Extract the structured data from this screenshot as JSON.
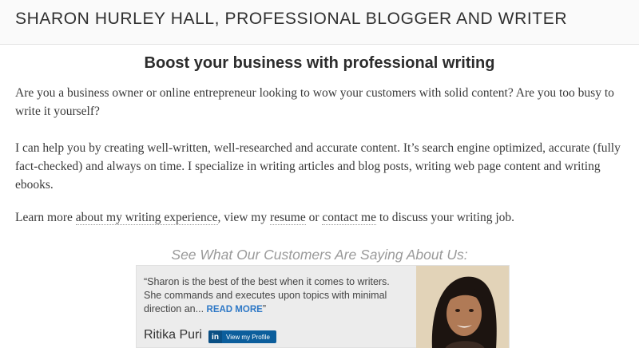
{
  "header": {
    "site_title": "SHARON HURLEY HALL, PROFESSIONAL BLOGGER AND WRITER"
  },
  "main": {
    "heading": "Boost your business with professional writing",
    "paragraph1": "Are you a business owner or online entrepreneur looking to wow your customers with solid content? Are you too busy to write it yourself?",
    "paragraph2": "I can help you by creating well-written, well-researched and accurate content. It’s search engine optimized, accurate (fully fact-checked) and always on time.  I specialize in writing articles and blog posts, writing web page content and writing ebooks.",
    "paragraph3": {
      "prefix": "Learn more ",
      "link_experience": "about my writing experience",
      "sep1": ",  view my ",
      "link_resume": "resume",
      "sep2": " or ",
      "link_contact": "contact me",
      "suffix": " to discuss your writing job."
    }
  },
  "testimonials": {
    "heading": "See What Our Customers Are Saying About Us:",
    "items": [
      {
        "quote": "“Sharon is the best of the best when it comes to writers. She commands and executes upon topics with minimal direction an...",
        "read_more": "READ MORE",
        "quote_close": "”",
        "name": "Ritika Puri",
        "profile_badge_logo": "in",
        "profile_badge_label": "View my Profile"
      }
    ]
  },
  "colors": {
    "link_blue": "#2e78c6",
    "linkedin_blue": "#0c5e9c",
    "card_bg": "#ececec"
  },
  "icons": {
    "linkedin": "linkedin-icon"
  }
}
